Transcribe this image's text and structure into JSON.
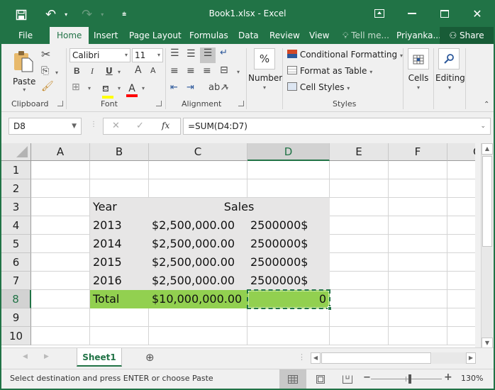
{
  "window": {
    "title": "Book1.xlsx - Excel",
    "buttons": {
      "ribbon_display": "⊡",
      "minimize": "—",
      "maximize": "☐",
      "close": "✕"
    }
  },
  "qat": {
    "save_icon": "💾",
    "undo_icon": "↶",
    "redo_icon": "↷",
    "customize_icon": "⩧"
  },
  "tabs": [
    {
      "label": "File"
    },
    {
      "label": "Home"
    },
    {
      "label": "Insert"
    },
    {
      "label": "Page Layout"
    },
    {
      "label": "Formulas"
    },
    {
      "label": "Data"
    },
    {
      "label": "Review"
    },
    {
      "label": "View"
    }
  ],
  "tell_me": "Tell me...",
  "user": "Priyanka...",
  "share": "Share",
  "ribbon": {
    "clipboard": {
      "label": "Clipboard",
      "paste": "Paste"
    },
    "font": {
      "label": "Font",
      "font_name": "Calibri",
      "font_size": "11",
      "bold": "B",
      "italic": "I",
      "underline": "U",
      "grow": "A",
      "shrink": "A",
      "highlight_color": "#ffff00",
      "font_color": "#ff0000"
    },
    "alignment": {
      "label": "Alignment"
    },
    "number": {
      "label": "Number",
      "icon": "%"
    },
    "styles": {
      "label": "Styles",
      "conditional": "Conditional Formatting",
      "format_table": "Format as Table",
      "cell_styles": "Cell Styles"
    },
    "cells": {
      "label": "Cells"
    },
    "editing": {
      "label": "Editing"
    }
  },
  "formula_bar": {
    "name_box": "D8",
    "cancel": "✕",
    "enter": "✓",
    "fx": "fx",
    "formula": "=SUM(D4:D7)"
  },
  "columns": [
    "A",
    "B",
    "C",
    "D",
    "E",
    "F",
    "G"
  ],
  "rows": [
    "1",
    "2",
    "3",
    "4",
    "5",
    "6",
    "7",
    "8",
    "9",
    "10"
  ],
  "cells": {
    "B3": "Year",
    "C3_D3": "Sales",
    "B4": "2013",
    "C4": "$2,500,000.00",
    "D4": "2500000$",
    "B5": "2014",
    "C5": "$2,500,000.00",
    "D5": "2500000$",
    "B6": "2015",
    "C6": "$2,500,000.00",
    "D6": "2500000$",
    "B7": "2016",
    "C7": "$2,500,000.00",
    "D7": "2500000$",
    "B8": "Total",
    "C8": "$10,000,000.00",
    "D8": "0"
  },
  "colors": {
    "accent": "#217346",
    "header_fill": "#e7e6e6",
    "total_fill": "#92d050"
  },
  "sheets": [
    {
      "name": "Sheet1",
      "active": true
    }
  ],
  "status": {
    "message": "Select destination and press ENTER or choose Paste",
    "zoom": "130%",
    "zoom_minus": "−",
    "zoom_plus": "+"
  }
}
